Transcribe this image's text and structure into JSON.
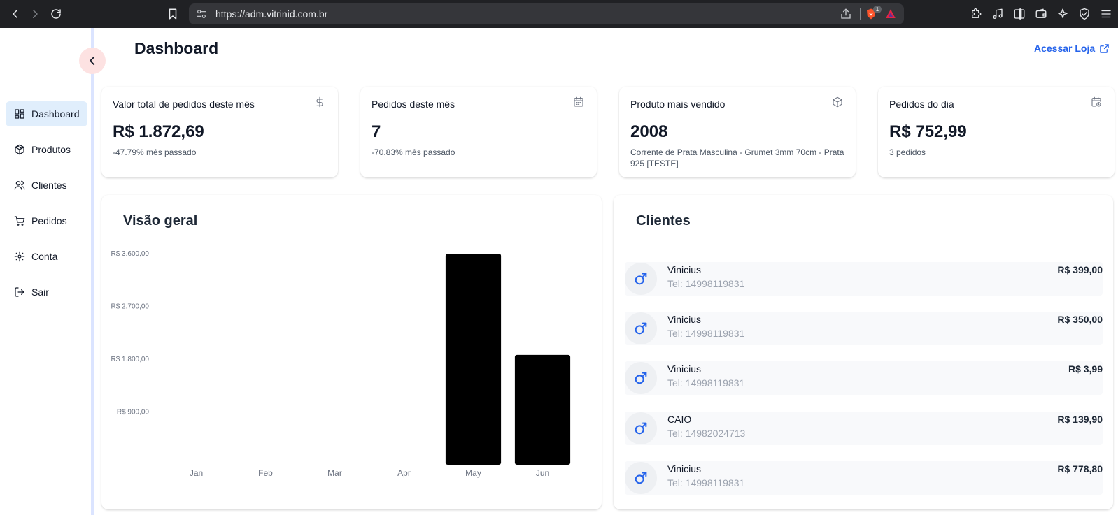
{
  "browser": {
    "url": "https://adm.vitrinid.com.br",
    "shield_badge": "1"
  },
  "sidebar": {
    "items": [
      {
        "label": "Dashboard",
        "icon": "dashboard-icon",
        "active": true
      },
      {
        "label": "Produtos",
        "icon": "package-icon"
      },
      {
        "label": "Clientes",
        "icon": "users-icon"
      },
      {
        "label": "Pedidos",
        "icon": "cart-icon"
      },
      {
        "label": "Conta",
        "icon": "gear-icon"
      },
      {
        "label": "Sair",
        "icon": "logout-icon"
      }
    ]
  },
  "header": {
    "title": "Dashboard",
    "store_link": "Acessar Loja"
  },
  "stats": [
    {
      "title": "Valor total de pedidos deste mês",
      "value": "R$ 1.872,69",
      "sub": "-47.79% mês passado",
      "icon": "dollar-icon"
    },
    {
      "title": "Pedidos deste mês",
      "value": "7",
      "sub": "-70.83% mês passado",
      "icon": "calendar-icon"
    },
    {
      "title": "Produto mais vendido",
      "value": "2008",
      "sub": "Corrente de Prata Masculina - Grumet 3mm 70cm - Prata 925 [TESTE]",
      "icon": "box-icon"
    },
    {
      "title": "Pedidos do dia",
      "value": "R$ 752,99",
      "sub": "3 pedidos",
      "icon": "calendar-clock-icon"
    }
  ],
  "overview": {
    "title": "Visão geral"
  },
  "chart_data": {
    "type": "bar",
    "categories": [
      "Jan",
      "Feb",
      "Mar",
      "Apr",
      "May",
      "Jun"
    ],
    "values": [
      0,
      0,
      0,
      0,
      3600,
      1872.69
    ],
    "y_ticks": [
      900,
      1800,
      2700,
      3600
    ],
    "y_tick_labels": [
      "R$ 900,00",
      "R$ 1.800,00",
      "R$ 2.700,00",
      "R$ 3.600,00"
    ],
    "ylim": [
      0,
      3600
    ],
    "bar_color": "#000000",
    "grid": false
  },
  "clients": {
    "title": "Clientes",
    "rows": [
      {
        "name": "Vinicius",
        "phone": "Tel: 14998119831",
        "amount": "R$ 399,00"
      },
      {
        "name": "Vinicius",
        "phone": "Tel: 14998119831",
        "amount": "R$ 350,00"
      },
      {
        "name": "Vinicius",
        "phone": "Tel: 14998119831",
        "amount": "R$ 3,99"
      },
      {
        "name": "CAIO",
        "phone": "Tel: 14982024713",
        "amount": "R$ 139,90"
      },
      {
        "name": "Vinicius",
        "phone": "Tel: 14998119831",
        "amount": "R$ 778,80"
      }
    ]
  },
  "colors": {
    "accent": "#2563eb",
    "active_nav": "#e0eefc",
    "collapse_button": "#fde2e2"
  }
}
